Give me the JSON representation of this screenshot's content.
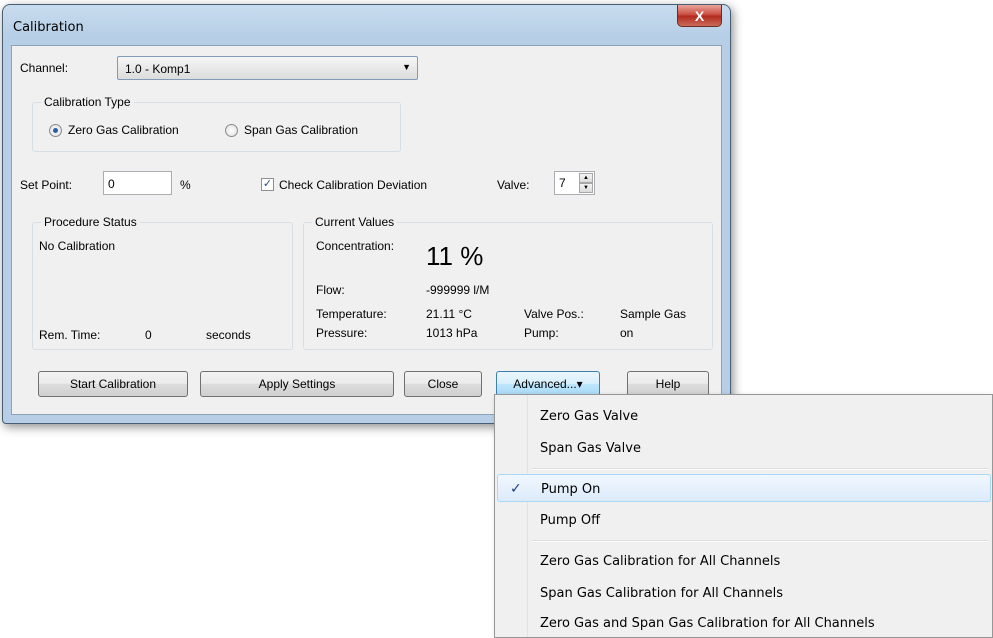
{
  "window": {
    "title": "Calibration",
    "close_glyph": "X"
  },
  "channel": {
    "label": "Channel:",
    "value": "1.0 - Komp1",
    "arrow": "▼"
  },
  "calibration_type": {
    "title": "Calibration Type",
    "options": [
      {
        "label": "Zero Gas Calibration",
        "selected": true
      },
      {
        "label": "Span Gas Calibration",
        "selected": false
      }
    ]
  },
  "setpoint": {
    "label": "Set Point:",
    "value": "0",
    "unit": "%"
  },
  "check_deviation": {
    "label": "Check Calibration Deviation",
    "checked": true,
    "mark": "✓"
  },
  "valve": {
    "label": "Valve:",
    "value": "7"
  },
  "procedure_status": {
    "title": "Procedure Status",
    "status": "No Calibration",
    "rem_label": "Rem. Time:",
    "rem_value": "0",
    "rem_unit": "seconds"
  },
  "current_values": {
    "title": "Current Values",
    "concentration_label": "Concentration:",
    "concentration_value": "11 %",
    "flow_label": "Flow:",
    "flow_value": "-999999 l/M",
    "temperature_label": "Temperature:",
    "temperature_value": "21.11 °C",
    "pressure_label": "Pressure:",
    "pressure_value": "1013 hPa",
    "valve_pos_label": "Valve Pos.:",
    "valve_pos_value": "Sample Gas",
    "pump_label": "Pump:",
    "pump_value": "on"
  },
  "buttons": {
    "start": "Start Calibration",
    "apply": "Apply Settings",
    "close": "Close",
    "advanced": "Advanced...",
    "advanced_arrow": "▾",
    "help": "Help"
  },
  "menu": {
    "items": [
      {
        "label": "Zero Gas Valve"
      },
      {
        "label": "Span Gas Valve"
      },
      {
        "label": "Pump On",
        "checked": true,
        "check": "✓"
      },
      {
        "label": "Pump Off"
      },
      {
        "label": "Zero Gas Calibration for All Channels"
      },
      {
        "label": "Span Gas Calibration for All Channels"
      },
      {
        "label": "Zero Gas and Span Gas Calibration for All Channels"
      }
    ]
  }
}
